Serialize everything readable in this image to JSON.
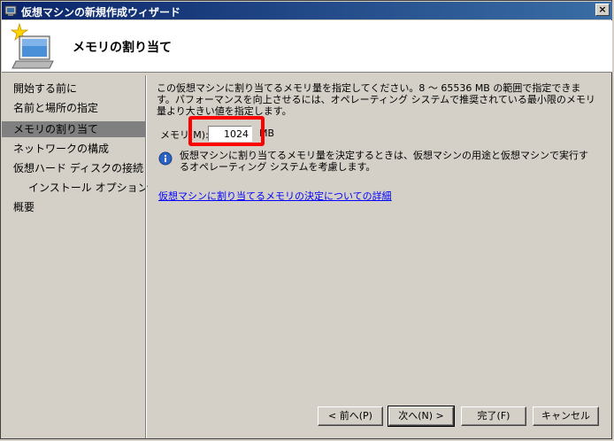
{
  "window": {
    "title": "仮想マシンの新規作成ウィザード",
    "close_label": "×"
  },
  "header": {
    "title": "メモリの割り当て",
    "icon": "computer-wizard-icon"
  },
  "nav": {
    "items": [
      {
        "label": "開始する前に",
        "selected": false
      },
      {
        "label": "名前と場所の指定",
        "selected": false
      },
      {
        "label": "メモリの割り当て",
        "selected": true
      },
      {
        "label": "ネットワークの構成",
        "selected": false
      },
      {
        "label": "仮想ハード ディスクの接続",
        "selected": false
      },
      {
        "label": "インストール オプション",
        "selected": false
      },
      {
        "label": "概要",
        "selected": false
      }
    ]
  },
  "main": {
    "description": "この仮想マシンに割り当てるメモリ量を指定してください。8 ～ 65536 MB の範囲で指定できます。パフォーマンスを向上させるには、オペレーティング システムで推奨されている最小限のメモリ量より大きい値を指定します。",
    "memory_label": "メモリ(M):",
    "memory_value": "1024",
    "memory_unit": "MB",
    "info_text": "仮想マシンに割り当てるメモリ量を決定するときは、仮想マシンの用途と仮想マシンで実行するオペレーティング システムを考慮します。",
    "link_text": "仮想マシンに割り当てるメモリの決定についての詳細"
  },
  "buttons": {
    "prev": "< 前へ(P)",
    "next": "次へ(N) >",
    "finish": "完了(F)",
    "cancel": "キャンセル"
  },
  "colors": {
    "highlight": "#ff0000",
    "link": "#0000ff",
    "titlebar": "#0a246a"
  }
}
